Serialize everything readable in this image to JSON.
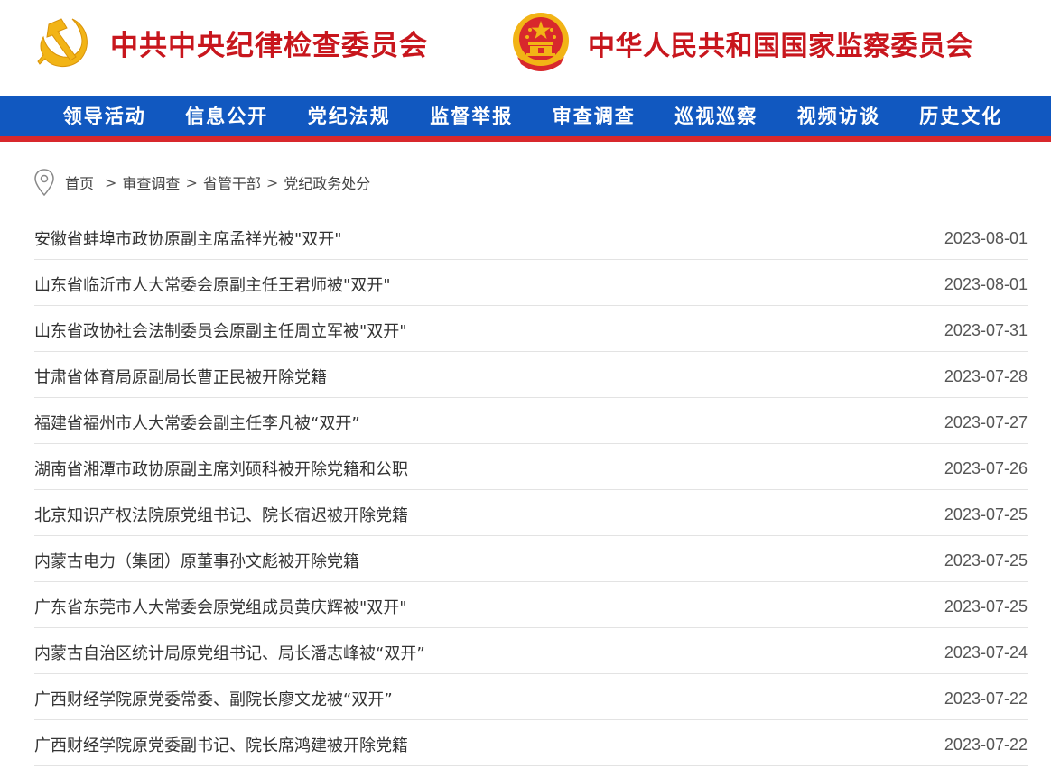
{
  "header": {
    "ccdi_title": "中共中央纪律检查委员会",
    "nsc_title": "中华人民共和国国家监察委员会",
    "ccdi_logo_icon": "party-emblem-icon",
    "nsc_logo_icon": "national-emblem-icon"
  },
  "nav": {
    "items": [
      {
        "label": "领导活动"
      },
      {
        "label": "信息公开"
      },
      {
        "label": "党纪法规"
      },
      {
        "label": "监督举报"
      },
      {
        "label": "审查调查"
      },
      {
        "label": "巡视巡察"
      },
      {
        "label": "视频访谈"
      },
      {
        "label": "历史文化"
      }
    ]
  },
  "breadcrumb": {
    "icon": "location-pin-icon",
    "items": [
      {
        "label": "首页"
      },
      {
        "label": "审查调查"
      },
      {
        "label": "省管干部"
      },
      {
        "label": "党纪政务处分"
      }
    ],
    "separator": ">"
  },
  "list": {
    "items": [
      {
        "title": "安徽省蚌埠市政协原副主席孟祥光被\"双开\"",
        "date": "2023-08-01"
      },
      {
        "title": "山东省临沂市人大常委会原副主任王君师被\"双开\"",
        "date": "2023-08-01"
      },
      {
        "title": "山东省政协社会法制委员会原副主任周立军被\"双开\"",
        "date": "2023-07-31"
      },
      {
        "title": "甘肃省体育局原副局长曹正民被开除党籍",
        "date": "2023-07-28"
      },
      {
        "title": "福建省福州市人大常委会副主任李凡被“双开”",
        "date": "2023-07-27"
      },
      {
        "title": "湖南省湘潭市政协原副主席刘硕科被开除党籍和公职",
        "date": "2023-07-26"
      },
      {
        "title": "北京知识产权法院原党组书记、院长宿迟被开除党籍",
        "date": "2023-07-25"
      },
      {
        "title": "内蒙古电力（集团）原董事孙文彪被开除党籍",
        "date": "2023-07-25"
      },
      {
        "title": "广东省东莞市人大常委会原党组成员黄庆辉被\"双开\"",
        "date": "2023-07-25"
      },
      {
        "title": "内蒙古自治区统计局原党组书记、局长潘志峰被“双开”",
        "date": "2023-07-24"
      },
      {
        "title": "广西财经学院原党委常委、副院长廖文龙被“双开”",
        "date": "2023-07-22"
      },
      {
        "title": "广西财经学院原党委副书记、院长席鸿建被开除党籍",
        "date": "2023-07-22"
      }
    ]
  },
  "colors": {
    "brand_red": "#c8161d",
    "nav_blue": "#1158c0",
    "nav_red_stripe": "#d8282c",
    "gold": "#f2b416"
  }
}
